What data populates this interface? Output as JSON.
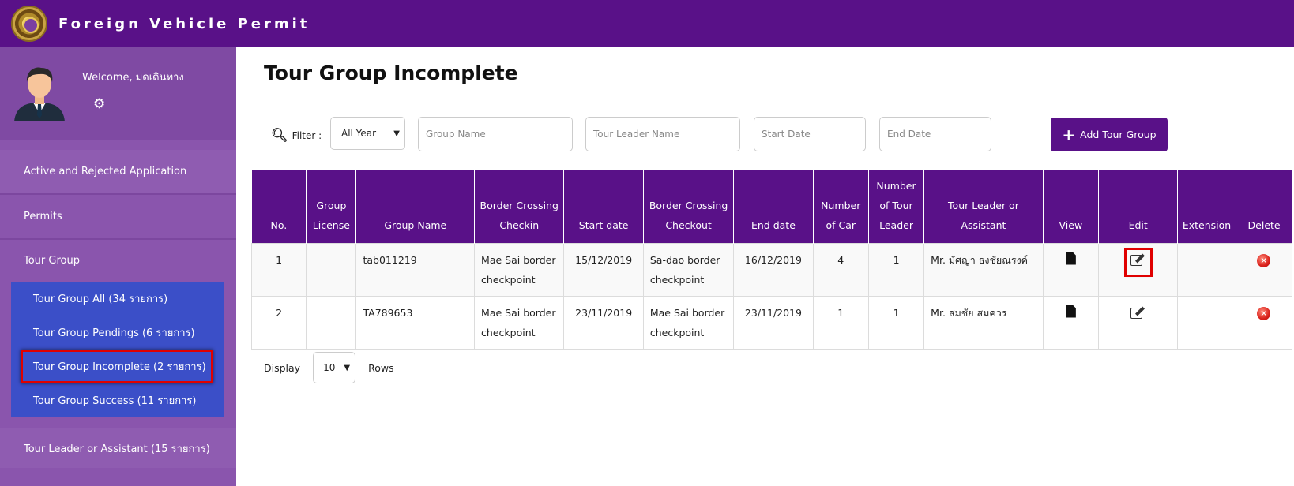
{
  "header": {
    "title": "Foreign Vehicle Permit",
    "logo_icon": "emblem-logo-icon"
  },
  "sidebar": {
    "welcome": "Welcome, มดเดินทาง",
    "items": [
      {
        "label": "Active and Rejected Application"
      },
      {
        "label": "Permits"
      },
      {
        "label": "Tour Group"
      }
    ],
    "tour_group_sub": [
      {
        "label": "Tour Group All (34 รายการ)"
      },
      {
        "label": "Tour Group Pendings (6 รายการ)"
      },
      {
        "label": "Tour Group Incomplete (2 รายการ)",
        "active": true
      },
      {
        "label": "Tour Group Success (11 รายการ)"
      }
    ],
    "leader": {
      "label": "Tour Leader or Assistant (15 รายการ)"
    }
  },
  "main": {
    "title": "Tour Group Incomplete",
    "filter": {
      "label": "Filter :",
      "year": "All Year",
      "group_name_placeholder": "Group Name",
      "leader_name_placeholder": "Tour Leader Name",
      "start_date_placeholder": "Start Date",
      "end_date_placeholder": "End Date",
      "add_label": "Add Tour Group"
    },
    "table": {
      "headers": {
        "no": "No.",
        "license": "Group License",
        "name": "Group Name",
        "checkin": "Border Crossing Checkin",
        "start": "Start date",
        "checkout": "Border Crossing Checkout",
        "end": "End date",
        "cars": "Number of Car",
        "leaders": "Number of Tour Leader",
        "leader_name": "Tour Leader or Assistant",
        "view": "View",
        "edit": "Edit",
        "extension": "Extension",
        "delete": "Delete"
      },
      "rows": [
        {
          "no": "1",
          "license": "",
          "name": "tab011219",
          "checkin": "Mae Sai border checkpoint",
          "start": "15/12/2019",
          "checkout": "Sa-dao border checkpoint",
          "end": "16/12/2019",
          "cars": "4",
          "leaders": "1",
          "leader_name": "Mr. มัศญา ธงชัยณรงค์",
          "extension": ""
        },
        {
          "no": "2",
          "license": "",
          "name": "TA789653",
          "checkin": "Mae Sai border checkpoint",
          "start": "23/11/2019",
          "checkout": "Mae Sai border checkpoint",
          "end": "23/11/2019",
          "cars": "1",
          "leaders": "1",
          "leader_name": "Mr. สมชัย สมควร",
          "extension": ""
        }
      ]
    },
    "pagination": {
      "display_label": "Display",
      "rows_value": "10",
      "rows_label": "Rows"
    }
  },
  "colors": {
    "primary": "#591188",
    "sidebar": "#8a55ad",
    "submenu": "#3b4fc8",
    "highlight": "#e00000"
  }
}
